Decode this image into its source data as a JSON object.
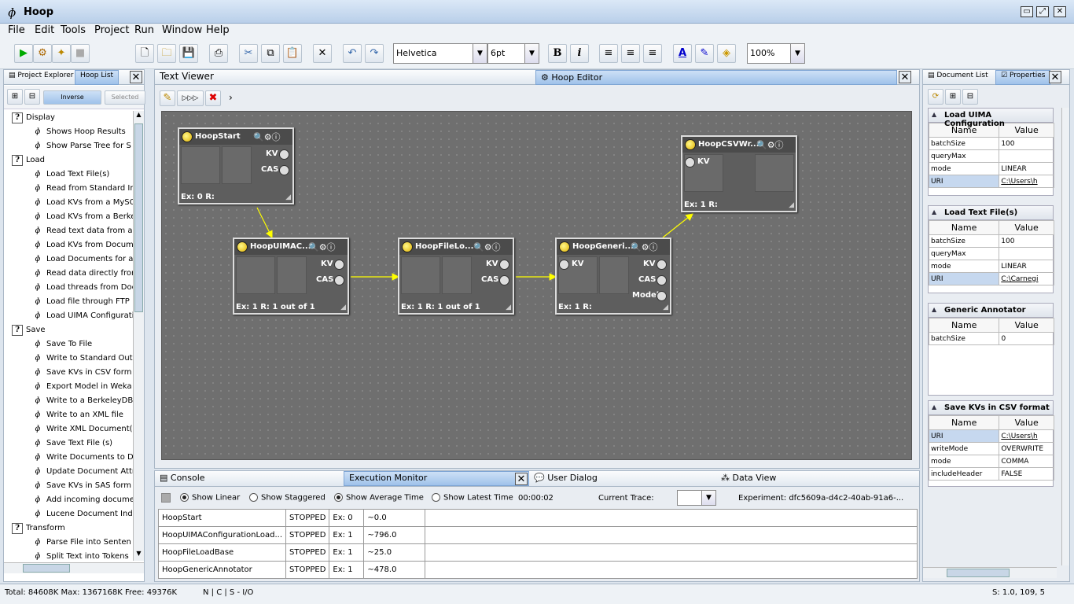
{
  "app": {
    "title": "Hoop"
  },
  "menu": [
    "File",
    "Edit",
    "Tools",
    "Project",
    "Run",
    "Window",
    "Help"
  ],
  "toolbar": {
    "font": "Helvetica",
    "size": "6pt",
    "zoom": "100%",
    "bold": "B",
    "italic": "i"
  },
  "left_panel": {
    "tabs": [
      "Project Explorer",
      "Hoop List"
    ],
    "buttons": {
      "inverse": "Inverse",
      "selected": "Selected"
    },
    "tree": [
      {
        "label": "Display",
        "cat": true
      },
      {
        "label": "Shows Hoop Results"
      },
      {
        "label": "Show Parse Tree for S"
      },
      {
        "label": "Load",
        "cat": true
      },
      {
        "label": "Load Text File(s)"
      },
      {
        "label": "Read from Standard In"
      },
      {
        "label": "Load KVs from a MySQ"
      },
      {
        "label": "Load KVs from a Berke"
      },
      {
        "label": "Read text data from a"
      },
      {
        "label": "Load KVs from Docum"
      },
      {
        "label": "Load Documents for a"
      },
      {
        "label": "Read data directly from"
      },
      {
        "label": "Load threads from Doc"
      },
      {
        "label": "Load file through FTP"
      },
      {
        "label": "Load UIMA Configurati"
      },
      {
        "label": "Save",
        "cat": true
      },
      {
        "label": "Save To File"
      },
      {
        "label": "Write to Standard Outp"
      },
      {
        "label": "Save KVs in CSV form"
      },
      {
        "label": "Export Model in Weka"
      },
      {
        "label": "Write to a BerkeleyDB"
      },
      {
        "label": "Write to an XML file"
      },
      {
        "label": "Write XML Document(s"
      },
      {
        "label": "Save Text File (s)"
      },
      {
        "label": "Write Documents to Do"
      },
      {
        "label": "Update Document Attri"
      },
      {
        "label": "Save KVs in SAS form"
      },
      {
        "label": "Add incoming docume"
      },
      {
        "label": "Lucene Document Inde"
      },
      {
        "label": "Transform",
        "cat": true
      },
      {
        "label": "Parse File into Senten"
      },
      {
        "label": "Split Text into Tokens"
      }
    ]
  },
  "center": {
    "tabs": [
      "Text Viewer",
      "Hoop Editor"
    ],
    "nodes": [
      {
        "name": "HoopStart",
        "outs": [
          "KV",
          "CAS"
        ],
        "ins": [],
        "footer": "Ex: 0 R:"
      },
      {
        "name": "HoopUIMAC...",
        "outs": [
          "KV",
          "CAS"
        ],
        "ins": [],
        "footer": "Ex: 1 R: 1 out of 1"
      },
      {
        "name": "HoopFileLo...",
        "outs": [
          "KV",
          "CAS"
        ],
        "ins": [],
        "footer": "Ex: 1 R: 1 out of 1"
      },
      {
        "name": "HoopGeneri...",
        "outs": [
          "KV",
          "CAS",
          "Model"
        ],
        "ins": [
          "KV"
        ],
        "footer": "Ex: 1 R:"
      },
      {
        "name": "HoopCSVWr...",
        "outs": [],
        "ins": [
          "KV"
        ],
        "footer": "Ex: 1 R:"
      }
    ]
  },
  "bottom": {
    "tabs": [
      "Console",
      "Execution Monitor",
      "User Dialog",
      "Data View"
    ],
    "options": {
      "linear": "Show Linear",
      "staggered": "Show Staggered",
      "avg": "Show Average Time",
      "latest": "Show Latest Time"
    },
    "time": "00:00:02",
    "trace_label": "Current Trace:",
    "experiment": "Experiment: dfc5609a-d4c2-40ab-91a6-...",
    "rows": [
      [
        "HoopStart",
        "STOPPED",
        "Ex: 0",
        "~0.0"
      ],
      [
        "HoopUIMAConfigurationLoad...",
        "STOPPED",
        "Ex: 1",
        "~796.0"
      ],
      [
        "HoopFileLoadBase",
        "STOPPED",
        "Ex: 1",
        "~25.0"
      ],
      [
        "HoopGenericAnnotator",
        "STOPPED",
        "Ex: 1",
        "~478.0"
      ]
    ]
  },
  "right_panel": {
    "tabs": [
      "Document List",
      "Properties"
    ],
    "col_name": "Name",
    "col_value": "Value",
    "groups": [
      {
        "title": "Load UIMA Configuration",
        "props": [
          [
            "batchSize",
            "100"
          ],
          [
            "queryMax",
            ""
          ],
          [
            "mode",
            "LINEAR"
          ],
          [
            "URI",
            "C:\\Users\\h"
          ]
        ]
      },
      {
        "title": "Load Text File(s)",
        "props": [
          [
            "batchSize",
            "100"
          ],
          [
            "queryMax",
            ""
          ],
          [
            "mode",
            "LINEAR"
          ],
          [
            "URI",
            "C:\\Carnegi"
          ]
        ]
      },
      {
        "title": "Generic Annotator",
        "props": [
          [
            "batchSize",
            "0"
          ]
        ]
      },
      {
        "title": "Save KVs in CSV format",
        "props": [
          [
            "URI",
            "C:\\Users\\h"
          ],
          [
            "writeMode",
            "OVERWRITE"
          ],
          [
            "mode",
            "COMMA"
          ],
          [
            "includeHeader",
            "FALSE"
          ]
        ]
      }
    ]
  },
  "status": {
    "memory": "Total: 84608K Max: 1367168K Free: 49376K",
    "mode": "N | C | S - I/O",
    "version": "S: 1.0, 109, 5"
  }
}
